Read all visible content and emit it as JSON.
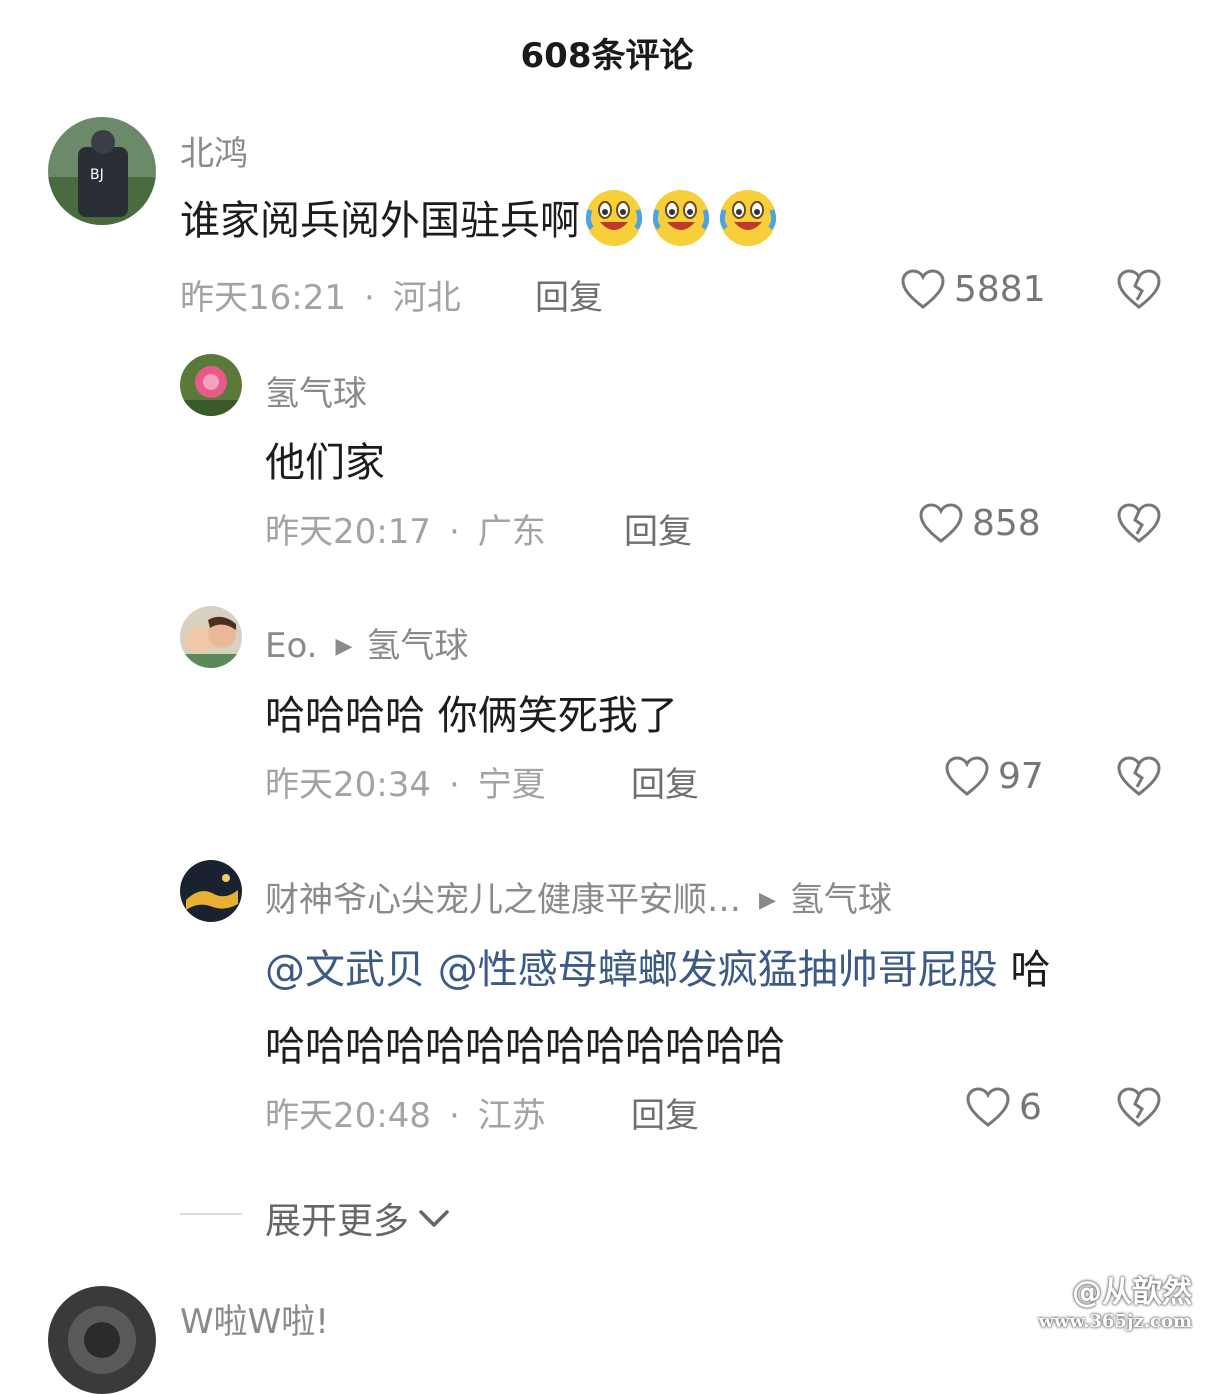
{
  "header": {
    "title": "608条评论"
  },
  "comments": [
    {
      "user": "北鸿",
      "text": "谁家阅兵阅外国驻兵啊",
      "time": "昨天16:21",
      "location": "河北",
      "reply_label": "回复",
      "likes": "5881",
      "emoji": "crying-laughing-emoji"
    },
    {
      "user": "氢气球",
      "text": "他们家",
      "time": "昨天20:17",
      "location": "广东",
      "reply_label": "回复",
      "likes": "858"
    },
    {
      "user": "Eo.",
      "reply_to": "氢气球",
      "text": "哈哈哈哈 你俩笑死我了",
      "time": "昨天20:34",
      "location": "宁夏",
      "reply_label": "回复",
      "likes": "97"
    },
    {
      "user": "财神爷心尖宠儿之健康平安顺…",
      "reply_to": "氢气球",
      "mention1": "@文武贝",
      "mention2": "@性感母蟑螂发疯猛抽帅哥屁股",
      "text_line1_tail": "哈",
      "text_line2": "哈哈哈哈哈哈哈哈哈哈哈哈哈",
      "time": "昨天20:48",
      "location": "江苏",
      "reply_label": "回复",
      "likes": "6"
    },
    {
      "user": "W啦W啦!"
    }
  ],
  "expand": {
    "label": "展开更多"
  },
  "watermark": {
    "line1": "@从歆然",
    "line2": "www.365jz.com"
  },
  "colors": {
    "mention": "#3b5a86",
    "meta": "#a3a3a3",
    "name": "#8a8a8a"
  }
}
